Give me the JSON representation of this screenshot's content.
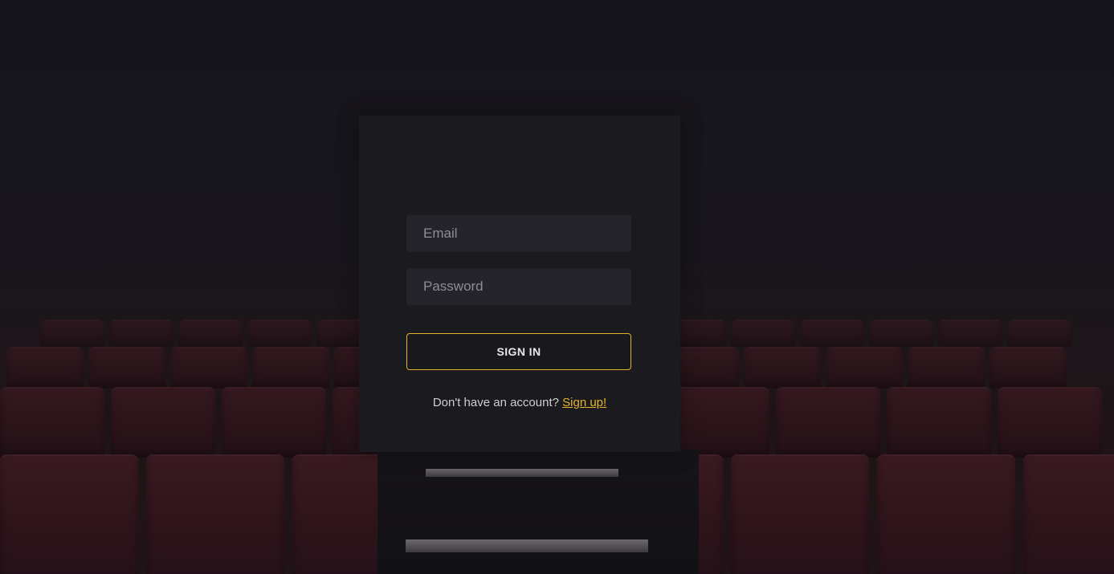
{
  "login": {
    "email_placeholder": "Email",
    "password_placeholder": "Password",
    "signin_label": "SIGN IN",
    "signup_prompt": "Don't have an account?",
    "signup_link": "Sign up!"
  },
  "colors": {
    "accent": "#e0b52c",
    "card_background": "#1b1a1f",
    "input_background": "#25242b",
    "seat_red": "#3a1a21"
  }
}
